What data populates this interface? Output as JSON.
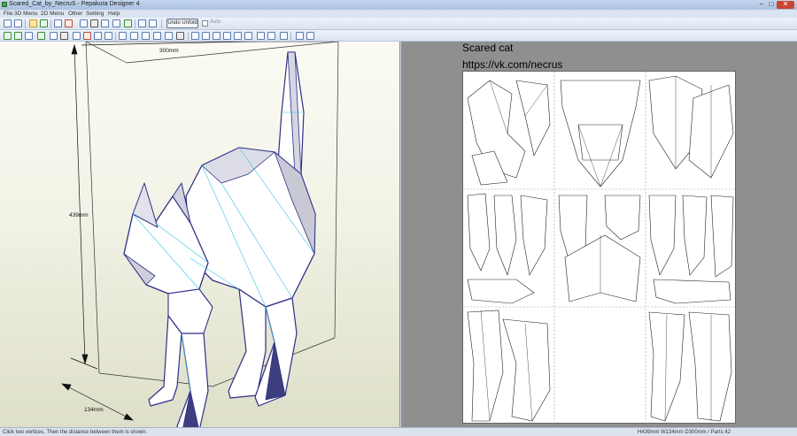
{
  "window": {
    "title": "Scared_Cat_by_NecruS - Pepakura Designer 4",
    "minimize_glyph": "–",
    "maximize_glyph": "□",
    "close_glyph": "✕"
  },
  "menu": [
    "File",
    "3D Menu",
    "2D Menu",
    "Other",
    "Setting",
    "Help"
  ],
  "toolbar": {
    "undo_unfold_label": "Undo Unfold",
    "auto_label": "Auto",
    "auto_checked": false
  },
  "view3d": {
    "dim_width": "300mm",
    "dim_height": "439mm",
    "dim_depth": "134mm",
    "background_top": "#fbfbf4",
    "background_bottom": "#dedfc8",
    "model_color": "#ffffff",
    "edge_color": "#2e2f86",
    "fold_color": "#38c5e6"
  },
  "view2d": {
    "title": "Scared cat",
    "url": "https://vk.com/necrus",
    "background": "#8f8f8f",
    "page_color": "#ffffff"
  },
  "status": {
    "message": "Click two vertices. Then the distance between them is shown.",
    "dimensions": "H439mm W134mm D300mm / Parts 42"
  }
}
